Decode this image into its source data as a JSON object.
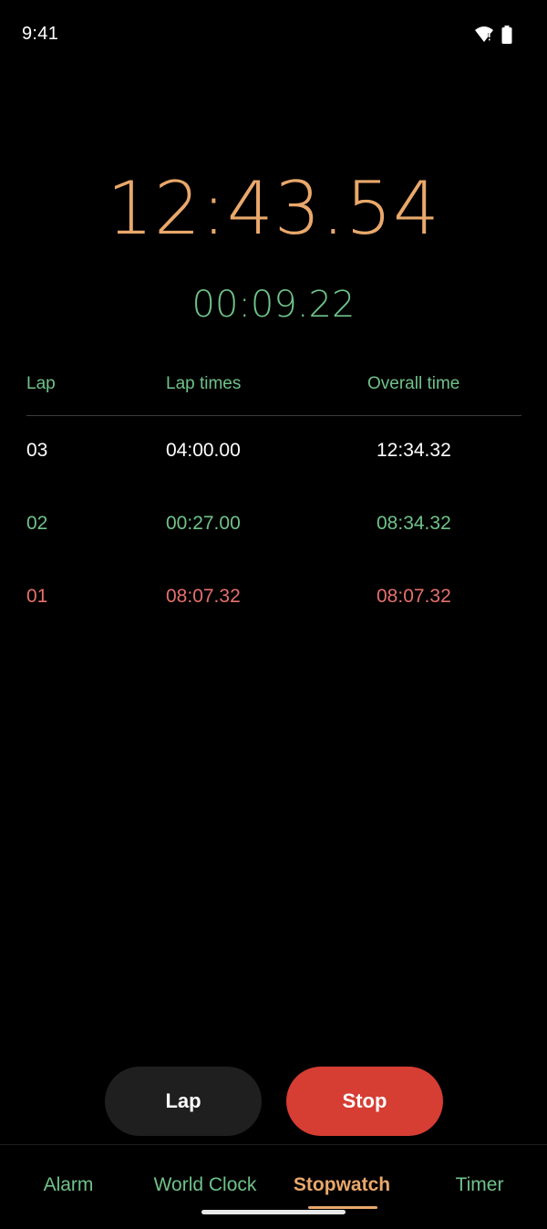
{
  "status_bar": {
    "time": "9:41",
    "icons": [
      "wifi-alert-icon",
      "battery-full-icon"
    ]
  },
  "stopwatch": {
    "total_time": "12:43.54",
    "current_lap_time": "00:09.22"
  },
  "lap_table": {
    "headers": {
      "lap": "Lap",
      "lap_times": "Lap times",
      "overall_time": "Overall time"
    },
    "rows": [
      {
        "lap": "03",
        "lap_time": "04:00.00",
        "overall": "12:34.32",
        "color": "#ffffff"
      },
      {
        "lap": "02",
        "lap_time": "00:27.00",
        "overall": "08:34.32",
        "color": "#6fc28a"
      },
      {
        "lap": "01",
        "lap_time": "08:07.32",
        "overall": "08:07.32",
        "color": "#e5706b"
      }
    ]
  },
  "controls": {
    "lap_label": "Lap",
    "stop_label": "Stop"
  },
  "bottom_nav": {
    "items": [
      {
        "label": "Alarm",
        "active": false
      },
      {
        "label": "World Clock",
        "active": false
      },
      {
        "label": "Stopwatch",
        "active": true
      },
      {
        "label": "Timer",
        "active": false
      }
    ]
  },
  "colors": {
    "background": "#000000",
    "accent_orange": "#e9a86b",
    "accent_green": "#6fc28a",
    "accent_red": "#e5706b",
    "stop_button": "#d63d33",
    "lap_button": "#1f1f1f"
  }
}
